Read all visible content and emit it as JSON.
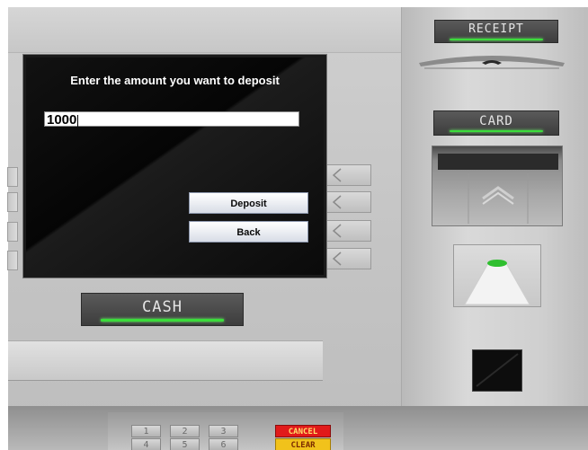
{
  "screen": {
    "prompt": "Enter the amount you want to deposit",
    "amount_value": "1000",
    "deposit_label": "Deposit",
    "back_label": "Back"
  },
  "labels": {
    "cash": "CASH",
    "receipt": "RECEIPT",
    "card": "CARD"
  },
  "keypad": {
    "keys_row1": [
      "1",
      "2",
      "3"
    ],
    "keys_row2": [
      "4",
      "5",
      "6"
    ],
    "cancel": "CANCEL",
    "clear": "CLEAR"
  },
  "colors": {
    "led_green": "#3bdc3b",
    "cancel_red": "#e11a1a",
    "clear_yellow": "#f1c21b"
  },
  "icons": {
    "side_key_glyph": "chevron-left-icon",
    "card_slot_glyph": "chevron-up-icon"
  }
}
